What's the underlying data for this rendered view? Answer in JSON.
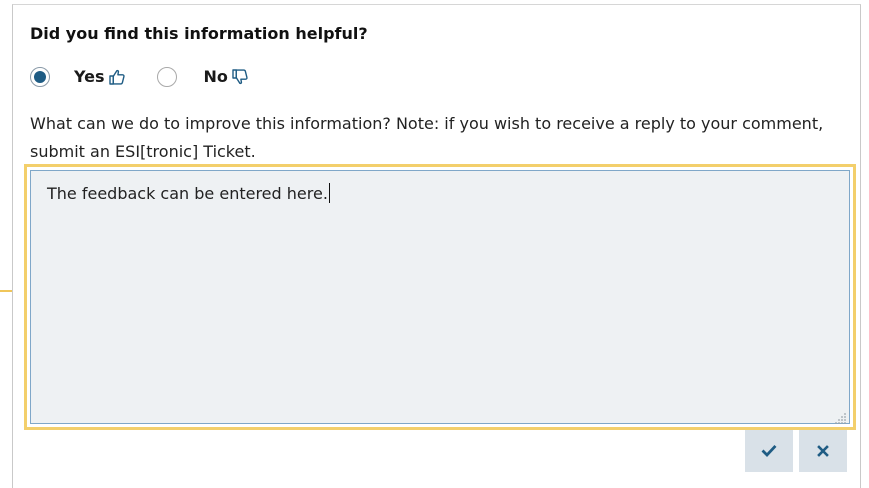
{
  "feedback": {
    "question": "Did you find this information helpful?",
    "options": [
      {
        "label": "Yes",
        "icon": "thumbs-up-icon",
        "selected": true
      },
      {
        "label": "No",
        "icon": "thumbs-down-icon",
        "selected": false
      }
    ],
    "prompt": "What can we do to improve this information? Note: if you wish to receive a reply to your comment, submit an ESI[tronic] Ticket.",
    "comment_value": "The feedback can be entered here.",
    "submit_icon": "checkmark-icon",
    "cancel_icon": "close-icon"
  },
  "colors": {
    "radio_selected": "#1f5c84",
    "focus_highlight": "#f3cf6b",
    "textarea_bg": "#eef1f3",
    "button_bg": "#d9e1e8",
    "icon_blue": "#1f5c84"
  }
}
